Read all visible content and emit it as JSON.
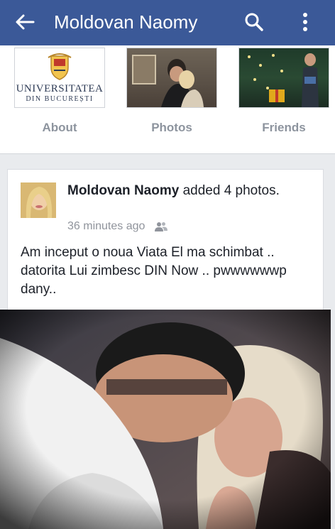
{
  "appbar": {
    "title": "Moldovan Naomy",
    "color": "#3b5998",
    "icons": [
      "back-arrow-icon",
      "search-icon",
      "more-vertical-icon"
    ]
  },
  "tiles": {
    "about": {
      "label": "About",
      "logo_text": "UNIVERSITATEA",
      "logo_subtext": "DIN BUCUREȘTI"
    },
    "photos": {
      "label": "Photos"
    },
    "friends": {
      "label": "Friends"
    }
  },
  "post": {
    "author": "Moldovan Naomy",
    "action": "added 4 photos.",
    "time": "36 minutes ago",
    "audience_icon": "friends-icon",
    "text": "Am inceput o noua Viata El ma schimbat .. datorita Lui zimbesc DIN Now .. pwwwwwwp dany.."
  }
}
